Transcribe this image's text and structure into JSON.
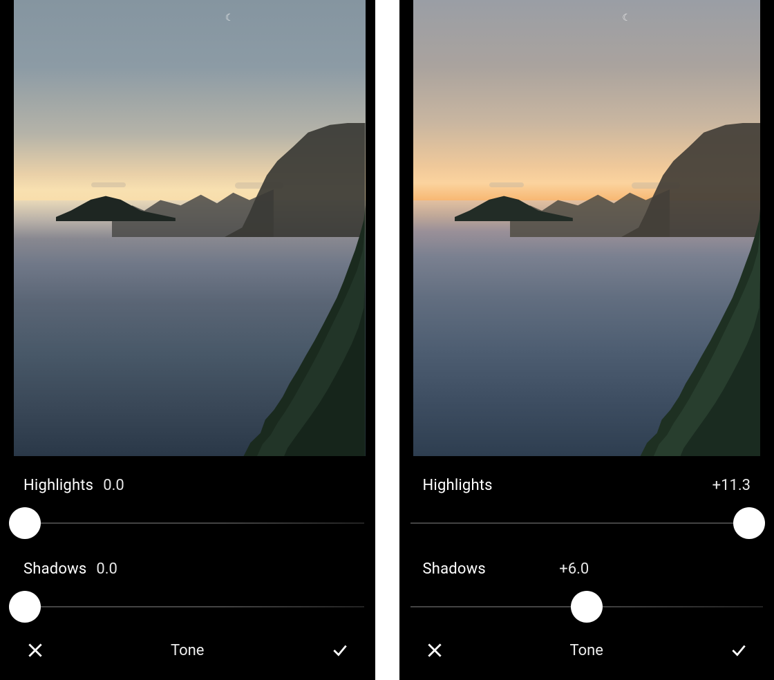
{
  "panels": [
    {
      "highlights_label": "Highlights",
      "highlights_value": "0.0",
      "highlights_pos_pct": 4,
      "shadows_label": "Shadows",
      "shadows_value": "0.0",
      "shadows_pos_pct": 4,
      "tone_label": "Tone",
      "variant": "a"
    },
    {
      "highlights_label": "Highlights",
      "highlights_value": "+11.3",
      "highlights_pos_pct": 96,
      "shadows_label": "Shadows",
      "shadows_value": "+6.0",
      "shadows_pos_pct": 50,
      "tone_label": "Tone",
      "variant": "b"
    }
  ],
  "icons": {
    "cancel": "close-icon",
    "confirm": "check-icon"
  }
}
